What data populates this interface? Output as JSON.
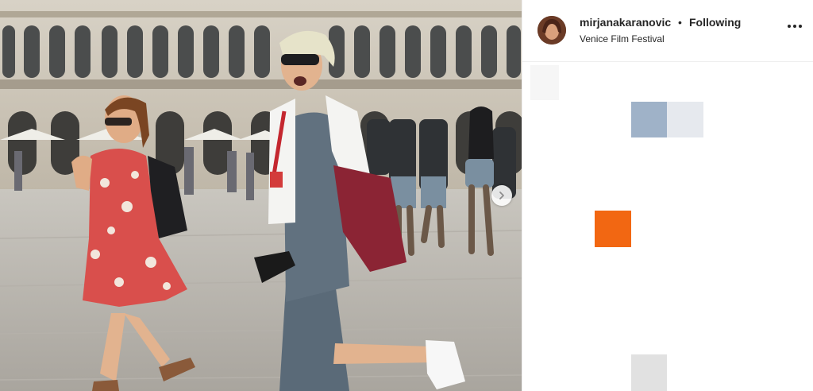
{
  "post": {
    "username": "mirjanakaranovic",
    "separator": "•",
    "follow_status": "Following",
    "location": "Venice Film Festival"
  },
  "photo": {
    "description_icon": "photo",
    "next_icon": "chevron-right-icon"
  },
  "placeholders": {
    "colors": [
      "#9fb2c8",
      "#e6e9ee",
      "#f26712",
      "#e1e1e1",
      "#f6f6f6"
    ]
  }
}
